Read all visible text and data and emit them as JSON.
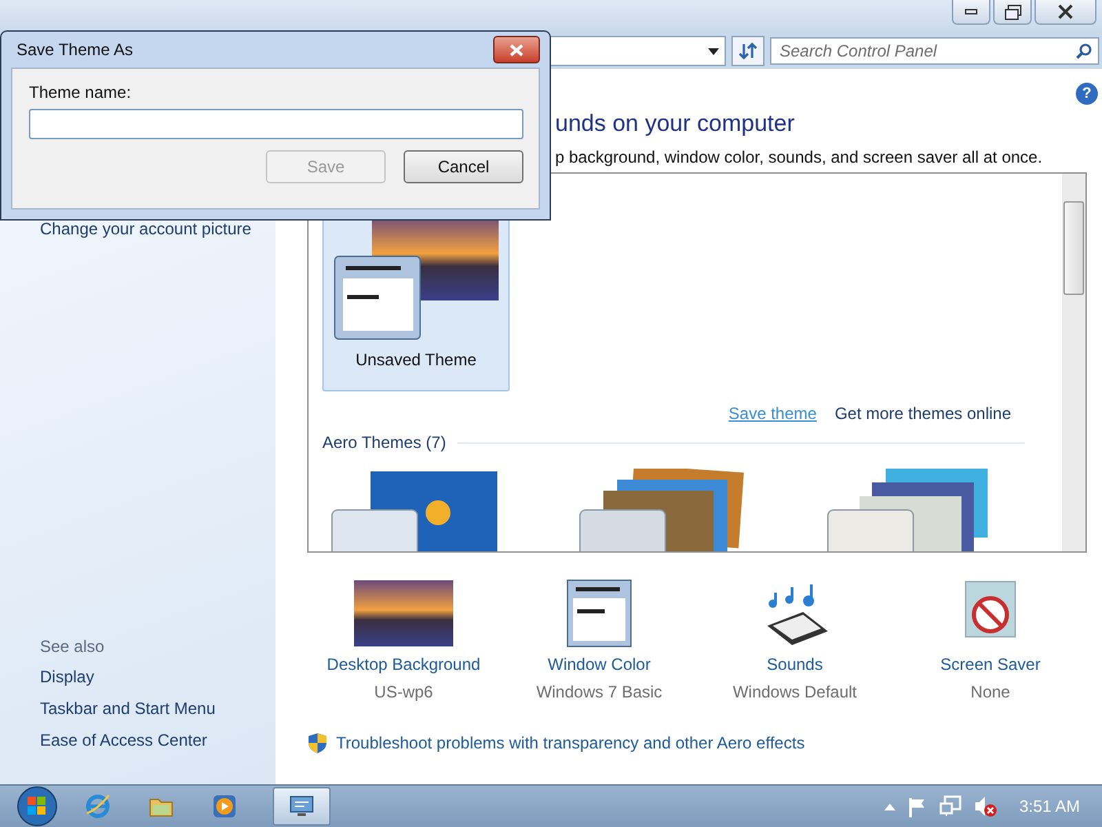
{
  "window": {
    "search": {
      "placeholder": "Search Control Panel"
    },
    "help": "?"
  },
  "sidebar": {
    "items": [
      {
        "label": "Change your account picture"
      }
    ],
    "see_also": {
      "heading": "See also",
      "links": [
        {
          "label": "Display"
        },
        {
          "label": "Taskbar and Start Menu"
        },
        {
          "label": "Ease of Access Center"
        }
      ]
    }
  },
  "main": {
    "heading": "unds on your computer",
    "subtitle": "p background, window color, sounds, and screen saver all at once.",
    "my_themes": [
      {
        "label": "Unsaved Theme",
        "selected": true
      }
    ],
    "links": [
      {
        "label": "Save theme",
        "hovered": true
      },
      {
        "label": "Get more themes online",
        "hovered": false
      }
    ],
    "aero_group": {
      "label": "Aero Themes (7)"
    },
    "settings": [
      {
        "kind": "background",
        "label": "Desktop Background",
        "value": "US-wp6"
      },
      {
        "kind": "color",
        "label": "Window Color",
        "value": "Windows 7 Basic"
      },
      {
        "kind": "sounds",
        "label": "Sounds",
        "value": "Windows Default"
      },
      {
        "kind": "saver",
        "label": "Screen Saver",
        "value": "None"
      }
    ],
    "troubleshoot": "Troubleshoot problems with transparency and other Aero effects"
  },
  "dialog": {
    "title": "Save Theme As",
    "field_label": "Theme name:",
    "buttons": [
      {
        "label": "Save",
        "disabled": true
      },
      {
        "label": "Cancel",
        "disabled": false
      }
    ]
  },
  "taskbar": {
    "items": [
      {
        "kind": "browser",
        "selected": false
      },
      {
        "kind": "folder",
        "selected": false
      },
      {
        "kind": "media",
        "selected": false
      },
      {
        "kind": "control",
        "selected": true
      }
    ],
    "clock": "3:51 AM"
  }
}
